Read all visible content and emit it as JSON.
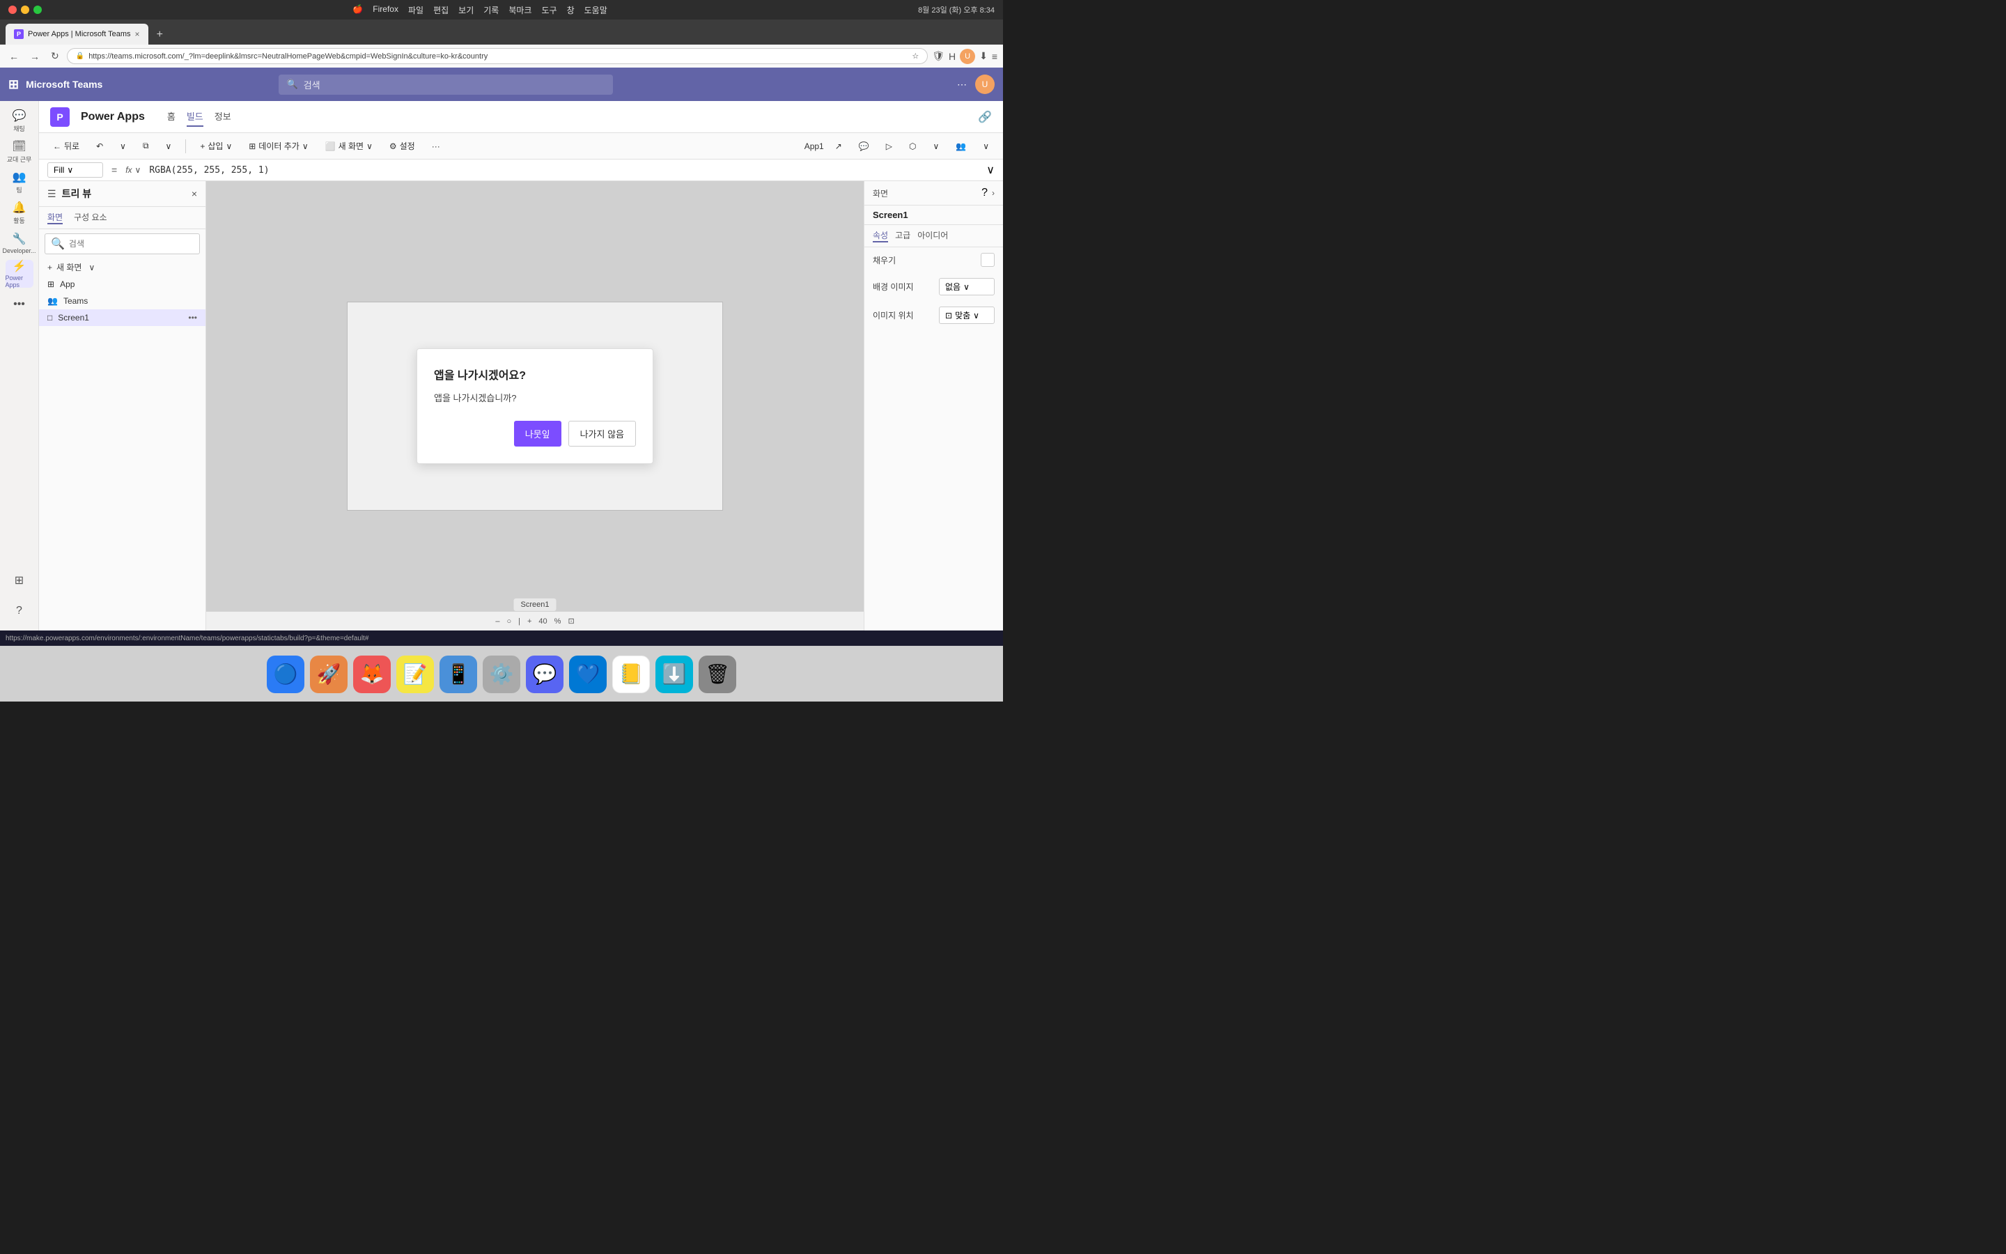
{
  "macos": {
    "menu_items": [
      "Firefox",
      "파일",
      "편집",
      "보기",
      "기록",
      "북마크",
      "도구",
      "창",
      "도움말"
    ],
    "date_time": "8월 23일 (화) 오후 8:34"
  },
  "browser": {
    "tab_title": "Power Apps | Microsoft Teams",
    "url": "https://teams.microsoft.com/_?lm=deeplink&lmsrc=NeutralHomePageWeb&cmpid=WebSignIn&culture=ko-kr&country",
    "new_tab_label": "+",
    "tab_close": "×"
  },
  "teams_header": {
    "app_name": "Microsoft Teams",
    "search_placeholder": "검색",
    "more_options": "⋯"
  },
  "sidebar": {
    "items": [
      {
        "id": "chat",
        "label": "채팅",
        "icon": "💬"
      },
      {
        "id": "work",
        "label": "교대 근무",
        "icon": "🗓"
      },
      {
        "id": "teams",
        "label": "팀",
        "icon": "👥"
      },
      {
        "id": "activity",
        "label": "활동",
        "icon": "🔔"
      },
      {
        "id": "developer",
        "label": "Developer...",
        "icon": "🔧"
      },
      {
        "id": "powerapps",
        "label": "Power Apps",
        "icon": "⚡"
      },
      {
        "id": "more",
        "label": "···",
        "icon": "···"
      }
    ],
    "bottom_items": [
      {
        "id": "grid",
        "label": "",
        "icon": "⊞"
      },
      {
        "id": "help",
        "label": "",
        "icon": "?"
      }
    ]
  },
  "powerapps": {
    "logo_letter": "P",
    "title": "Power Apps",
    "nav_items": [
      "홈",
      "빌드",
      "정보"
    ],
    "active_nav": "빌드"
  },
  "toolbar": {
    "back_label": "뒤로",
    "undo_label": "↶",
    "redo_label": "↷",
    "insert_label": "삽입",
    "data_label": "데이터 추가",
    "screen_label": "새 화면",
    "settings_label": "설정",
    "more_label": "···",
    "app_label": "App1"
  },
  "formula_bar": {
    "dropdown_value": "Fill",
    "fx_label": "fx",
    "formula_value": "RGBA(255, 255, 255, 1)",
    "expand_icon": "∨"
  },
  "tree_view": {
    "title": "트리 뷰",
    "tabs": [
      "화면",
      "구성 요소"
    ],
    "active_tab": "화면",
    "search_placeholder": "검색",
    "new_screen_label": "새 화면",
    "items": [
      {
        "id": "app",
        "label": "App",
        "icon": "⊞",
        "level": 0
      },
      {
        "id": "teams",
        "label": "Teams",
        "icon": "👥",
        "level": 0
      },
      {
        "id": "screen1",
        "label": "Screen1",
        "icon": "□",
        "level": 0
      }
    ]
  },
  "dialog": {
    "title": "앱을 나가시겠어요?",
    "body": "앱을 나가시겠습니까?",
    "primary_button": "나뭇잎",
    "secondary_button": "나가지 않음"
  },
  "canvas_bottom": {
    "zoom_out": "–",
    "zoom_circle": "○",
    "divider": "|",
    "zoom_in": "+",
    "zoom_value": "40",
    "zoom_unit": "%",
    "expand": "⊡"
  },
  "right_panel": {
    "title": "화면",
    "screen_name": "Screen1",
    "tabs": [
      "속성",
      "고급",
      "아이디어"
    ],
    "active_tab": "속성",
    "properties": [
      {
        "label": "채우기",
        "value": "",
        "has_color": true
      },
      {
        "label": "배경 이미지",
        "dropdown": "없음"
      },
      {
        "label": "이미지 위치",
        "dropdown": "맞춤",
        "has_icon": true
      }
    ]
  },
  "status_bar": {
    "url": "https://make.powerapps.com/environments/:environmentName/teams/powerapps/statictabs/build?p=&theme=default#"
  },
  "dock": {
    "items": [
      {
        "id": "finder",
        "label": "",
        "emoji": "🔵",
        "bg": "#2a5bdb"
      },
      {
        "id": "launchpad",
        "label": "",
        "emoji": "🚀",
        "bg": "#e84"
      },
      {
        "id": "firefox",
        "label": "",
        "emoji": "🦊",
        "bg": "#e55"
      },
      {
        "id": "notes",
        "label": "",
        "emoji": "📝",
        "bg": "#f5e642"
      },
      {
        "id": "appstore",
        "label": "",
        "emoji": "📱",
        "bg": "#4a90d9"
      },
      {
        "id": "settings",
        "label": "",
        "emoji": "⚙️",
        "bg": "#aaa"
      },
      {
        "id": "discord",
        "label": "",
        "emoji": "💬",
        "bg": "#5865f2"
      },
      {
        "id": "vscode",
        "label": "",
        "emoji": "💙",
        "bg": "#0078d4"
      },
      {
        "id": "notion",
        "label": "",
        "emoji": "📒",
        "bg": "#fff"
      },
      {
        "id": "downloader",
        "label": "",
        "emoji": "⬇️",
        "bg": "#00b4d8"
      },
      {
        "id": "trash",
        "label": "",
        "emoji": "🗑",
        "bg": "#888"
      }
    ]
  }
}
